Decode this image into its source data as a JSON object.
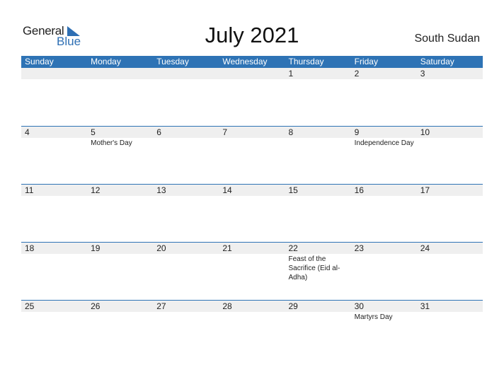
{
  "logo": {
    "general": "General",
    "blue": "Blue"
  },
  "title": "July 2021",
  "country": "South Sudan",
  "colors": {
    "header": "#2e73b5",
    "stripe": "#efefef"
  },
  "days_of_week": [
    "Sunday",
    "Monday",
    "Tuesday",
    "Wednesday",
    "Thursday",
    "Friday",
    "Saturday"
  ],
  "weeks": [
    [
      {
        "day": ""
      },
      {
        "day": ""
      },
      {
        "day": ""
      },
      {
        "day": ""
      },
      {
        "day": "1"
      },
      {
        "day": "2"
      },
      {
        "day": "3"
      }
    ],
    [
      {
        "day": "4"
      },
      {
        "day": "5",
        "event": "Mother's Day"
      },
      {
        "day": "6"
      },
      {
        "day": "7"
      },
      {
        "day": "8"
      },
      {
        "day": "9",
        "event": "Independence Day"
      },
      {
        "day": "10"
      }
    ],
    [
      {
        "day": "11"
      },
      {
        "day": "12"
      },
      {
        "day": "13"
      },
      {
        "day": "14"
      },
      {
        "day": "15"
      },
      {
        "day": "16"
      },
      {
        "day": "17"
      }
    ],
    [
      {
        "day": "18"
      },
      {
        "day": "19"
      },
      {
        "day": "20"
      },
      {
        "day": "21"
      },
      {
        "day": "22",
        "event": "Feast of the Sacrifice (Eid al-Adha)"
      },
      {
        "day": "23"
      },
      {
        "day": "24"
      }
    ],
    [
      {
        "day": "25"
      },
      {
        "day": "26"
      },
      {
        "day": "27"
      },
      {
        "day": "28"
      },
      {
        "day": "29"
      },
      {
        "day": "30",
        "event": "Martyrs Day"
      },
      {
        "day": "31"
      }
    ]
  ]
}
